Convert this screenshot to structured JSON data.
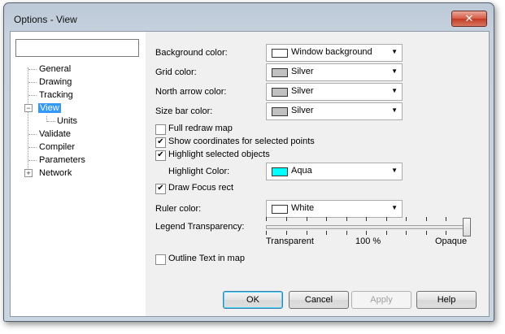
{
  "window": {
    "title": "Options - View",
    "close_symbol": "✕"
  },
  "tree": {
    "search_value": "",
    "items": [
      {
        "label": "General"
      },
      {
        "label": "Drawing"
      },
      {
        "label": "Tracking"
      },
      {
        "label": "View",
        "expander": "−"
      },
      {
        "label": "Units"
      },
      {
        "label": "Validate"
      },
      {
        "label": "Compiler"
      },
      {
        "label": "Parameters"
      },
      {
        "label": "Network",
        "expander": "+"
      }
    ]
  },
  "view": {
    "background_color": {
      "label": "Background color:",
      "value": "Window background",
      "swatch": "#ffffff"
    },
    "grid_color": {
      "label": "Grid color:",
      "value": "Silver",
      "swatch": "#c0c0c0"
    },
    "north_arrow_color": {
      "label": "North arrow color:",
      "value": "Silver",
      "swatch": "#c0c0c0"
    },
    "size_bar_color": {
      "label": "Size bar color:",
      "value": "Silver",
      "swatch": "#c0c0c0"
    },
    "full_redraw_map": {
      "label": "Full redraw map",
      "checked": false
    },
    "show_coordinates": {
      "label": "Show coordinates for selected points",
      "checked": true
    },
    "highlight_selected": {
      "label": "Highlight selected objects",
      "checked": true
    },
    "highlight_color": {
      "label": "Highlight Color:",
      "value": "Aqua",
      "swatch": "#00ffff"
    },
    "draw_focus_rect": {
      "label": "Draw Focus rect",
      "checked": true
    },
    "ruler_color": {
      "label": "Ruler color:",
      "value": "White",
      "swatch": "#ffffff"
    },
    "legend_transparency": {
      "label": "Legend Transparency:",
      "min_label": "Transparent",
      "mid_label": "100 %",
      "max_label": "Opaque",
      "value_percent": 100
    },
    "outline_text": {
      "label": "Outline Text in map",
      "checked": false
    }
  },
  "buttons": {
    "ok": "OK",
    "cancel": "Cancel",
    "apply": "Apply",
    "help": "Help"
  },
  "glyphs": {
    "check": "✔",
    "arrow": "▼"
  }
}
